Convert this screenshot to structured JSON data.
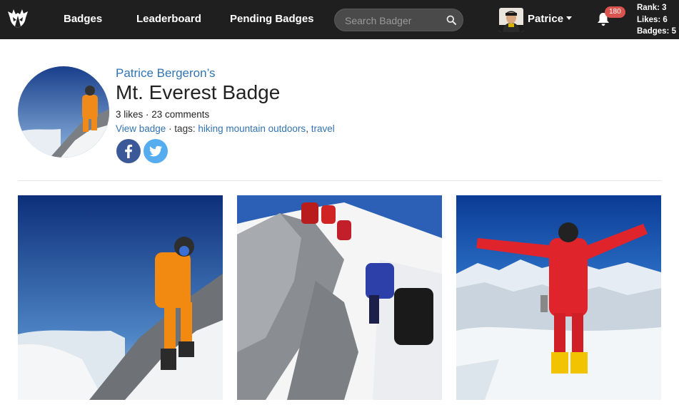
{
  "navbar": {
    "links": [
      "Badges",
      "Leaderboard",
      "Pending Badges"
    ],
    "search_placeholder": "Search Badger",
    "user_name": "Patrice",
    "notification_count": "180",
    "stats": {
      "rank": "Rank: 3",
      "likes": "Likes: 6",
      "badges": "Badges: 5"
    },
    "icons": {
      "logo": "badger-logo-icon",
      "search": "search-icon",
      "bell": "bell-icon",
      "caret": "caret-down-icon"
    }
  },
  "badge": {
    "owner": "Patrice Bergeron’s",
    "title": "Mt. Everest Badge",
    "likes_comments": "3 likes · 23 comments",
    "view_link": "View badge",
    "tags_prefix": " · tags: ",
    "tag_1": "hiking mountain outdoors",
    "tag_sep": ", ",
    "tag_2": "travel",
    "share": [
      "facebook-icon",
      "twitter-icon"
    ]
  },
  "colors": {
    "navbar_bg": "#1f1f1f",
    "link_blue": "#3273b0",
    "notification_red": "#d9534f",
    "facebook_blue": "#3b5998",
    "twitter_blue": "#55acee"
  },
  "gallery": [
    "climber-orange-suit-photo",
    "climbers-on-ridge-photo",
    "climber-red-suit-summit-photo"
  ]
}
